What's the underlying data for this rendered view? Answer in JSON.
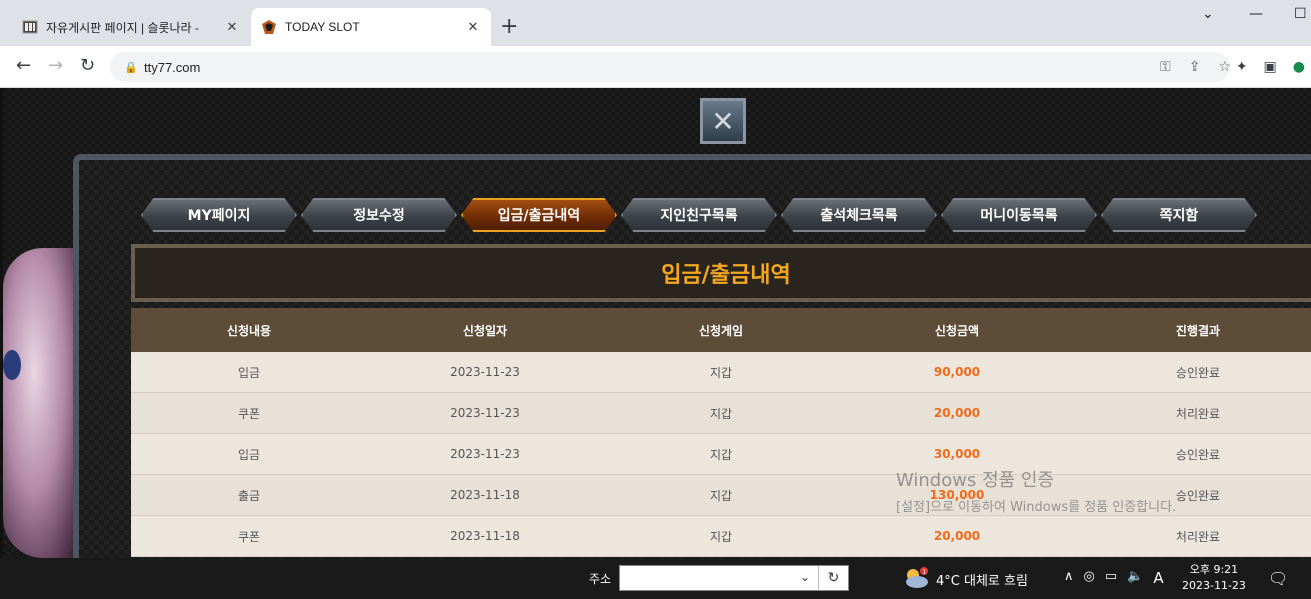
{
  "browser": {
    "tabs": [
      {
        "title": "자유게시판 페이지 | 슬롯나라 -",
        "active": false
      },
      {
        "title": "TODAY SLOT",
        "active": true
      }
    ],
    "url": "tty77.com",
    "icons": {
      "back": "arrow-left-icon",
      "forward": "arrow-right-icon",
      "reload": "reload-icon",
      "key": "key-icon",
      "share": "share-icon",
      "star": "star-icon",
      "extensions": "puzzle-icon",
      "sidebar": "sidebar-icon"
    }
  },
  "page": {
    "menu": [
      {
        "label": "MY페이지",
        "active": false
      },
      {
        "label": "정보수정",
        "active": false
      },
      {
        "label": "입금/출금내역",
        "active": true
      },
      {
        "label": "지인친구목록",
        "active": false
      },
      {
        "label": "출석체크목록",
        "active": false
      },
      {
        "label": "머니이동목록",
        "active": false
      },
      {
        "label": "쪽지함",
        "active": false
      }
    ],
    "section_title": "입금/출금내역",
    "table": {
      "headers": [
        "신청내용",
        "신청일자",
        "신청게임",
        "신청금액",
        "진행결과"
      ],
      "rows": [
        [
          "입금",
          "2023-11-23",
          "지갑",
          "90,000",
          "승인완료"
        ],
        [
          "쿠폰",
          "2023-11-23",
          "지갑",
          "20,000",
          "처리완료"
        ],
        [
          "입금",
          "2023-11-23",
          "지갑",
          "30,000",
          "승인완료"
        ],
        [
          "출금",
          "2023-11-18",
          "지갑",
          "130,000",
          "승인완료"
        ],
        [
          "쿠폰",
          "2023-11-18",
          "지갑",
          "20,000",
          "처리완료"
        ]
      ]
    },
    "colors": {
      "accent": "#f5a81d",
      "amount": "#f16b1a",
      "header_bg": "#5d4c38"
    }
  },
  "watermark": {
    "line1": "Windows 정품 인증",
    "line2": "[설정]으로 이동하여 Windows를 정품 인증합니다."
  },
  "taskbar": {
    "address_label": "주소",
    "weather": "4°C  대체로 흐림",
    "clock_time": "오후 9:21",
    "clock_date": "2023-11-23",
    "ime": "A"
  }
}
